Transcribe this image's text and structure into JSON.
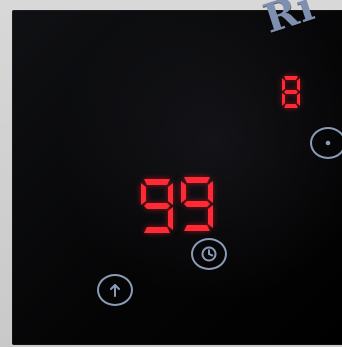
{
  "panel": {
    "brand_text": "Ri",
    "displays": {
      "small_digit": "8",
      "main_digits": "99"
    },
    "buttons": {
      "up": {
        "icon": "arrow-up-icon"
      },
      "timer": {
        "icon": "clock-icon"
      },
      "power": {
        "icon": "dot-circle-icon"
      }
    },
    "colors": {
      "led_red": "#ff2a36",
      "button_outline": "#8a9bb5",
      "brand": "#7f8fb0"
    }
  }
}
